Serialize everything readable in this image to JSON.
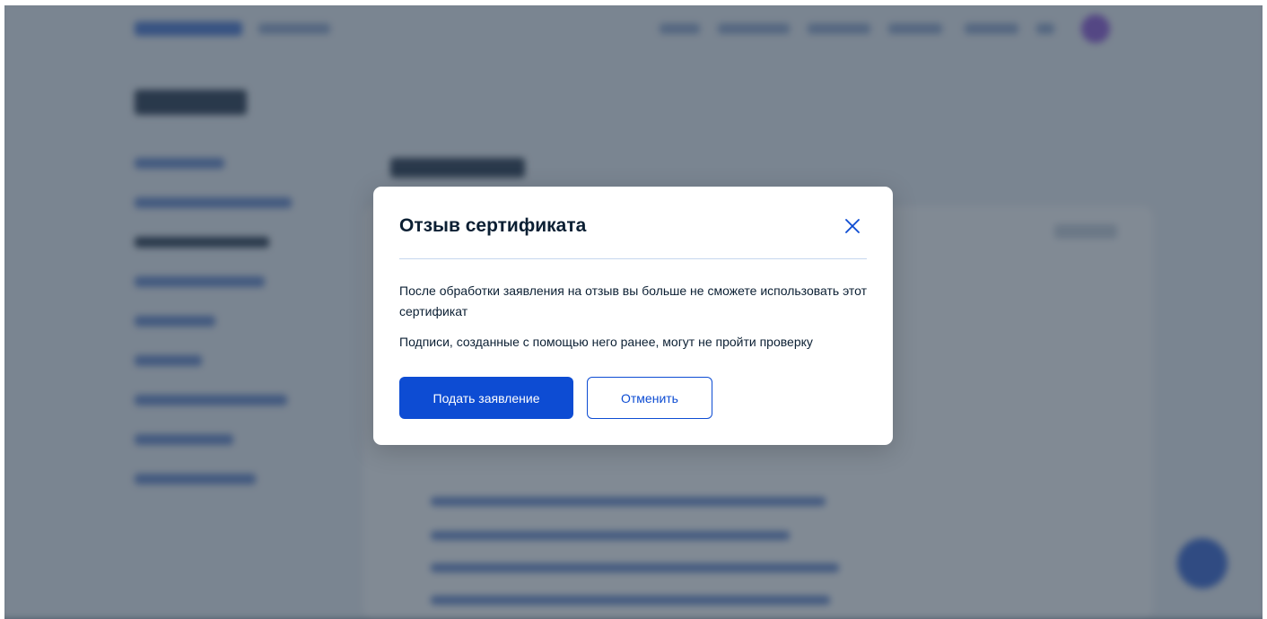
{
  "modal": {
    "title": "Отзыв сертификата",
    "close_icon": "close-icon",
    "paragraph_1": "После обработки заявления на отзыв вы больше не сможете использовать этот сертификат",
    "paragraph_2": "Подписи, созданные с помощью него ранее, могут не пройти проверку",
    "submit_label": "Подать заявление",
    "cancel_label": "Отменить"
  },
  "colors": {
    "accent": "#0d4cd3",
    "text": "#0b1f33",
    "divider": "#c6d6ee",
    "overlay": "#6b7885"
  }
}
